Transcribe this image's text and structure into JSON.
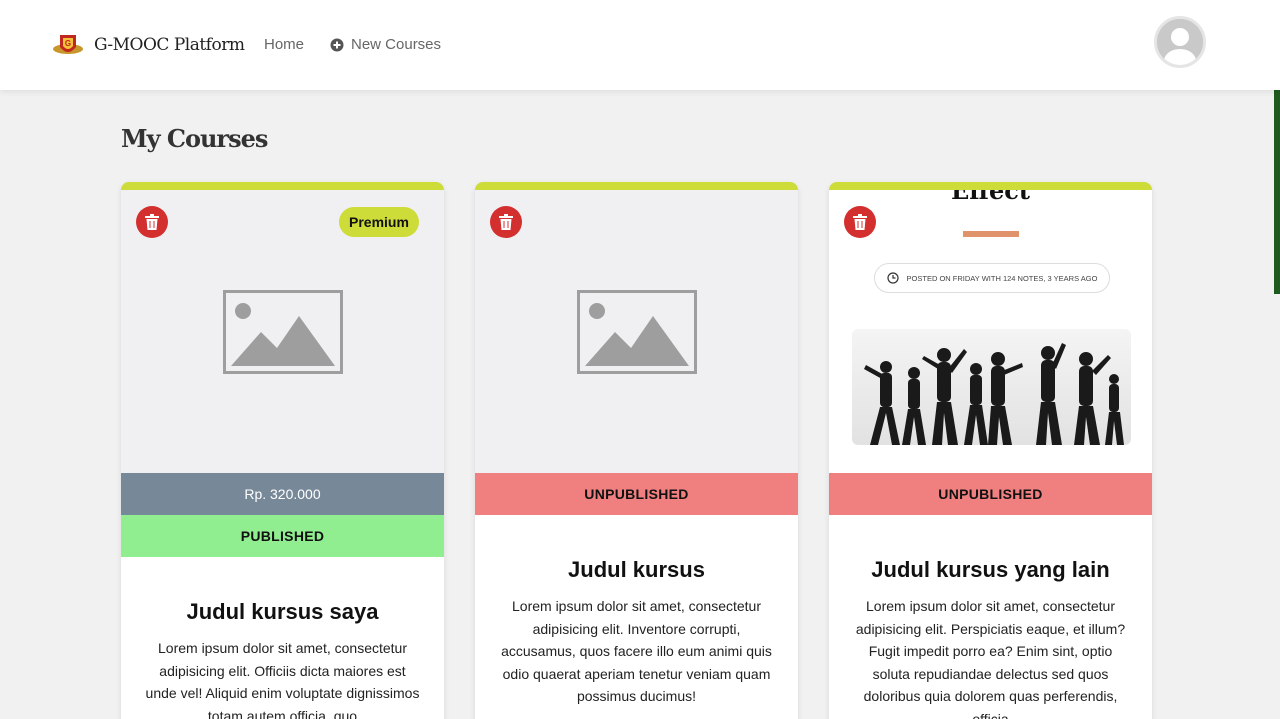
{
  "navbar": {
    "brand": "G-MOOC Platform",
    "links": [
      {
        "label": "Home"
      },
      {
        "label": "New Courses",
        "icon": "plus-circle-icon"
      }
    ],
    "avatar": "user-avatar-icon"
  },
  "page": {
    "title": "My Courses"
  },
  "colors": {
    "accent": "#cddc39",
    "published": "#90ee90",
    "unpublished": "#f08080",
    "price": "#778899",
    "delete": "#d32f2f"
  },
  "courses": [
    {
      "badge": "Premium",
      "price": "Rp. 320.000",
      "status": "PUBLISHED",
      "title": "Judul kursus saya",
      "description": "Lorem ipsum dolor sit amet, consectetur adipisicing elit. Officiis dicta maiores est unde vel! Aliquid enim voluptate dignissimos totam autem officia, quo"
    },
    {
      "status": "UNPUBLISHED",
      "title": "Judul kursus",
      "description": "Lorem ipsum dolor sit amet, consectetur adipisicing elit. Inventore corrupti, accusamus, quos facere illo eum animi quis odio quaerat aperiam tenetur veniam quam possimus ducimus!"
    },
    {
      "status": "UNPUBLISHED",
      "title": "Judul kursus yang lain",
      "description": "Lorem ipsum dolor sit amet, consectetur adipisicing elit. Perspiciatis eaque, et illum? Fugit impedit porro ea? Enim sint, optio soluta repudiandae delectus sed quos doloribus quia dolorem quas perferendis, officia",
      "thumbnail": {
        "heading": "Effect",
        "meta": "POSTED ON FRIDAY WITH 124 NOTES, 3 YEARS AGO"
      }
    }
  ]
}
